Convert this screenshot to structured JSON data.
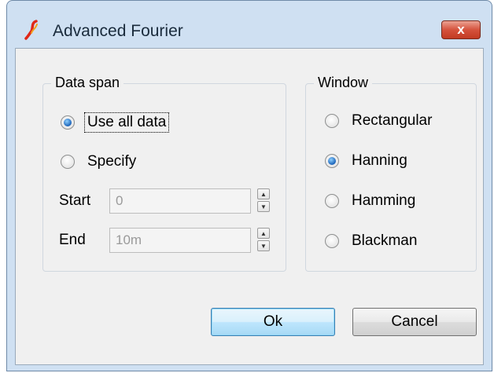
{
  "window": {
    "title": "Advanced Fourier",
    "close_label": "x"
  },
  "data_span": {
    "label": "Data span",
    "options": [
      {
        "label": "Use all data",
        "selected": true
      },
      {
        "label": "Specify",
        "selected": false
      }
    ],
    "start_label": "Start",
    "start_value": "0",
    "end_label": "End",
    "end_value": "10m"
  },
  "window_group": {
    "label": "Window",
    "options": [
      {
        "label": "Rectangular",
        "selected": false
      },
      {
        "label": "Hanning",
        "selected": true
      },
      {
        "label": "Hamming",
        "selected": false
      },
      {
        "label": "Blackman",
        "selected": false
      }
    ]
  },
  "buttons": {
    "ok": "Ok",
    "cancel": "Cancel"
  },
  "colors": {
    "title_bar": "#cfe0f2",
    "close_button": "#d5523c",
    "radio_selected": "#1a62b8",
    "default_button_border": "#3c7fb1"
  },
  "icons": {
    "app": "simetrix-s-logo-icon",
    "close": "close-icon",
    "spin_up": "chevron-up-icon",
    "spin_down": "chevron-down-icon"
  }
}
